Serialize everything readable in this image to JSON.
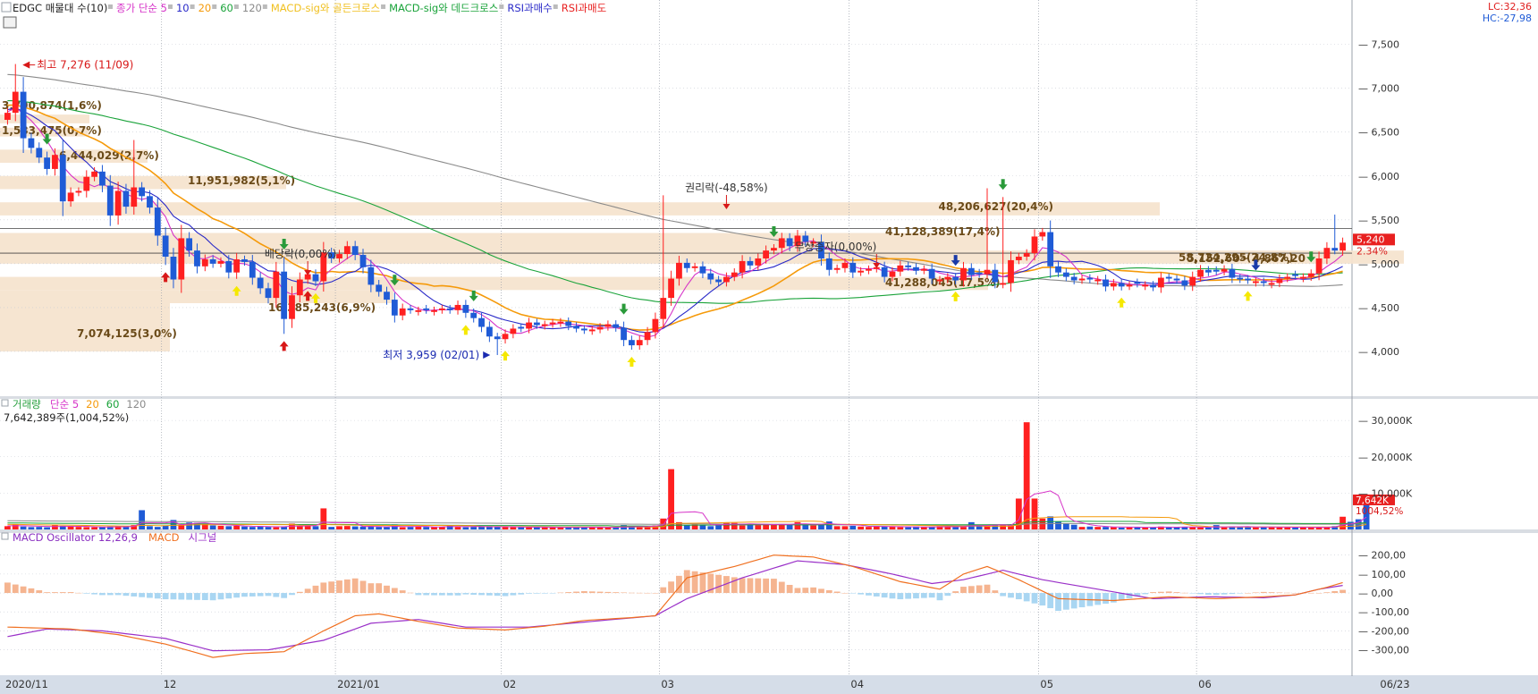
{
  "colors": {
    "up": "#ff2020",
    "down": "#1f5bd6",
    "ma5": "#d633c8",
    "ma10": "#2929c8",
    "ma20": "#f59a0a",
    "ma60": "#1aa33a",
    "ma120": "#8a8a8a",
    "grid": "#c8ccd4",
    "band": "#f5e4cf",
    "macd": "#f07020",
    "signal": "#9a30c8",
    "osc_pos": "#f5b490",
    "osc_neg": "#a9d6f2",
    "badge": "#e82020"
  },
  "chart_data": [
    {
      "type": "candlestick",
      "title": "EDGC 매물대 수(10)",
      "legend": [
        {
          "text": "종가 단순 5",
          "color": "#d633c8"
        },
        {
          "text": "10",
          "color": "#2929c8"
        },
        {
          "text": "20",
          "color": "#f59a0a"
        },
        {
          "text": "60",
          "color": "#1aa33a"
        },
        {
          "text": "120",
          "color": "#8a8a8a"
        },
        {
          "text": "MACD-sig와 골든크로스",
          "color": "#f0c020"
        },
        {
          "text": "MACD-sig와 데드크로스",
          "color": "#1aa33a"
        },
        {
          "text": "RSI과매수",
          "color": "#2929c8"
        },
        {
          "text": "RSI과매도",
          "color": "#e82020"
        }
      ],
      "corner": [
        "LC:32,36",
        "HC:-27,98"
      ],
      "ylim": [
        3500,
        7700
      ],
      "yticks": [
        4000,
        4500,
        5000,
        5500,
        6000,
        6500,
        7000,
        7500
      ],
      "ytick_labels": [
        "4,000",
        "4,500",
        "5,000",
        "5,500",
        "6,000",
        "6,500",
        "7,000",
        "7,500"
      ],
      "x_labels": [
        {
          "i": 0,
          "text": "2020/11"
        },
        {
          "i": 20,
          "text": "12"
        },
        {
          "i": 42,
          "text": "2021/01"
        },
        {
          "i": 63,
          "text": "02"
        },
        {
          "i": 83,
          "text": "03"
        },
        {
          "i": 107,
          "text": "04"
        },
        {
          "i": 131,
          "text": "05"
        },
        {
          "i": 151,
          "text": "06"
        },
        {
          "i": 169,
          "text": "06/23"
        }
      ],
      "closes": [
        6720,
        6960,
        6430,
        6320,
        6210,
        6080,
        6240,
        5710,
        5810,
        5830,
        5990,
        6050,
        5890,
        5550,
        5830,
        5650,
        5870,
        5770,
        5640,
        5320,
        5080,
        4820,
        5290,
        5150,
        4970,
        5050,
        5000,
        5030,
        4900,
        5050,
        5020,
        4840,
        4720,
        4610,
        4910,
        4370,
        4640,
        4820,
        4880,
        4800,
        5130,
        5060,
        5110,
        5200,
        5100,
        4960,
        4760,
        4680,
        4590,
        4410,
        4490,
        4470,
        4470,
        4470,
        4470,
        4490,
        4470,
        4530,
        4440,
        4380,
        4280,
        4170,
        4140,
        4200,
        4260,
        4260,
        4330,
        4300,
        4310,
        4330,
        4340,
        4290,
        4260,
        4240,
        4250,
        4280,
        4310,
        4270,
        4130,
        4070,
        4130,
        4220,
        4370,
        4610,
        4830,
        5010,
        4950,
        4970,
        4890,
        4820,
        4790,
        4850,
        4900,
        5030,
        4980,
        5060,
        5150,
        5180,
        5290,
        5200,
        5320,
        5250,
        5250,
        5060,
        4930,
        4950,
        5010,
        4900,
        4920,
        4940,
        4960,
        4850,
        4910,
        4980,
        4960,
        4920,
        4940,
        4830,
        4820,
        4850,
        4810,
        4950,
        4870,
        4880,
        4930,
        4790,
        4780,
        5040,
        5080,
        5120,
        5310,
        5360,
        4970,
        4900,
        4850,
        4810,
        4830,
        4820,
        4820,
        4740,
        4780,
        4740,
        4760,
        4770,
        4760,
        4730,
        4840,
        4830,
        4810,
        4750,
        4850,
        4930,
        4900,
        4910,
        4940,
        4840,
        4820,
        4810,
        4800,
        4780,
        4780,
        4830,
        4850,
        4860,
        4850,
        4890,
        5060,
        5180,
        5150,
        5240
      ],
      "series": [
        {
          "name": "종가 단순 5"
        },
        {
          "name": "10"
        },
        {
          "name": "20"
        },
        {
          "name": "60"
        },
        {
          "name": "120"
        }
      ],
      "price_badge": {
        "price": "5,240",
        "pct": "2.34%",
        "value": 5240
      },
      "volume_profile": [
        {
          "lo": 5550,
          "hi": 5700,
          "label": "48,206,627(20,4%)"
        },
        {
          "lo": 5000,
          "hi": 5150,
          "label": "58,724,295(24,8%)"
        },
        {
          "lo": 4550,
          "hi": 4700,
          "label": "16,385,243(6,9%)"
        },
        {
          "lo": 4700,
          "hi": 4850,
          "label": "41,288,045(17,5%)"
        },
        {
          "lo": 5150,
          "hi": 5350,
          "label": "41,128,389(17,4%)"
        },
        {
          "lo": 5850,
          "hi": 6000,
          "label": "11,951,982(5,1%)"
        },
        {
          "lo": 6150,
          "hi": 6300,
          "label": "6,444,029(2,7%)"
        },
        {
          "lo": 6450,
          "hi": 6550,
          "label": "1,583,475(0,7%)"
        },
        {
          "lo": 6600,
          "hi": 6700,
          "label": "3,790,874(1,6%)"
        },
        {
          "lo": 4000,
          "hi": 4550,
          "label": "7,074,125(3,0%)"
        }
      ],
      "range_text": "5,152,60~ 4,867,20",
      "high_note": "최고 7,276 (11/09)",
      "high_value": 7276,
      "low_note": "최저 3,959 (02/01)",
      "low_value": 3959,
      "events": [
        {
          "i": 38,
          "text": "배당락(0,00%)"
        },
        {
          "i": 91,
          "text": "권리락(-48,58%)"
        },
        {
          "i": 110,
          "text": "무상증자(0,00%)"
        }
      ],
      "signals": {
        "golden": [
          29,
          38,
          39,
          58,
          63,
          79,
          120,
          141,
          157
        ],
        "dead": [
          5,
          35,
          49,
          59,
          78,
          97,
          126,
          165
        ],
        "rsi_over": [
          120,
          158
        ],
        "rsi_under": [
          20,
          35,
          38
        ]
      }
    },
    {
      "type": "bar",
      "title": "거래량",
      "legend": [
        {
          "text": "단순 5",
          "color": "#d633c8"
        },
        {
          "text": "20",
          "color": "#f59a0a"
        },
        {
          "text": "60",
          "color": "#1aa33a"
        },
        {
          "text": "120",
          "color": "#8a8a8a"
        }
      ],
      "header_value": "7,642,389주(1,004,52%)",
      "ylim": [
        0,
        32000
      ],
      "yticks": [
        10000,
        20000,
        30000
      ],
      "ytick_labels": [
        "10,000K",
        "20,000K",
        "30,000K"
      ],
      "values": [
        900,
        1400,
        800,
        650,
        700,
        600,
        1200,
        1000,
        800,
        700,
        650,
        600,
        700,
        800,
        900,
        750,
        1200,
        5300,
        900,
        700,
        1000,
        2600,
        1300,
        1900,
        1800,
        1500,
        1100,
        1000,
        900,
        1000,
        800,
        700,
        900,
        700,
        600,
        800,
        1600,
        900,
        1000,
        900,
        5800,
        700,
        900,
        950,
        850,
        800,
        750,
        700,
        650,
        1400,
        600,
        700,
        800,
        700,
        650,
        700,
        1200,
        700,
        600,
        700,
        800,
        900,
        700,
        650,
        600,
        600,
        700,
        650,
        600,
        500,
        550,
        600,
        600,
        650,
        700,
        500,
        500,
        600,
        1200,
        800,
        700,
        700,
        1100,
        3000,
        16600,
        2000,
        1200,
        1400,
        1200,
        900,
        1600,
        1800,
        1800,
        1100,
        1500,
        1200,
        1500,
        1500,
        1400,
        1300,
        2000,
        1500,
        1100,
        1300,
        2200,
        900,
        900,
        1000,
        800,
        700,
        900,
        800,
        750,
        650,
        600,
        800,
        650,
        700,
        900,
        750,
        650,
        700,
        2000,
        900,
        1200,
        1200,
        1100,
        1100,
        8500,
        29500,
        8500,
        3000,
        3600,
        2200,
        1600,
        1300,
        700,
        800,
        700,
        700,
        600,
        500,
        650,
        700,
        500,
        550,
        800,
        600,
        650,
        700,
        600,
        600,
        500,
        1200,
        600,
        800,
        650,
        700,
        600,
        650,
        700,
        600,
        600,
        500,
        700,
        600,
        700,
        500,
        900,
        3500,
        2100,
        2800,
        7642
      ],
      "price_badge": {
        "value": "7,642K",
        "pct": "1004,52%"
      }
    },
    {
      "type": "line",
      "title": "MACD Oscillator 12,26,9",
      "legend": [
        {
          "text": "MACD",
          "color": "#f07020"
        },
        {
          "text": "시그널",
          "color": "#9a30c8"
        }
      ],
      "ylim": [
        -420,
        260
      ],
      "yticks": [
        -300,
        -200,
        -100,
        0,
        100,
        200
      ],
      "ytick_labels": [
        "-300,00",
        "-200,00",
        "-100,00",
        "0,00",
        "100,00",
        "200,00"
      ],
      "keyframes_macd": [
        [
          0,
          -180
        ],
        [
          8,
          -190
        ],
        [
          14,
          -220
        ],
        [
          20,
          -270
        ],
        [
          26,
          -340
        ],
        [
          30,
          -320
        ],
        [
          35,
          -310
        ],
        [
          40,
          -200
        ],
        [
          44,
          -120
        ],
        [
          47,
          -110
        ],
        [
          52,
          -150
        ],
        [
          57,
          -185
        ],
        [
          63,
          -195
        ],
        [
          68,
          -175
        ],
        [
          73,
          -145
        ],
        [
          79,
          -130
        ],
        [
          82,
          -120
        ],
        [
          86,
          80
        ],
        [
          92,
          140
        ],
        [
          97,
          200
        ],
        [
          102,
          190
        ],
        [
          107,
          140
        ],
        [
          113,
          60
        ],
        [
          118,
          20
        ],
        [
          121,
          100
        ],
        [
          124,
          140
        ],
        [
          128,
          70
        ],
        [
          133,
          -30
        ],
        [
          140,
          -40
        ],
        [
          147,
          -20
        ],
        [
          153,
          -30
        ],
        [
          159,
          -20
        ],
        [
          163,
          -10
        ],
        [
          167,
          30
        ],
        [
          169,
          55
        ]
      ],
      "keyframes_signal": [
        [
          0,
          -230
        ],
        [
          5,
          -190
        ],
        [
          12,
          -200
        ],
        [
          20,
          -240
        ],
        [
          26,
          -305
        ],
        [
          33,
          -300
        ],
        [
          40,
          -250
        ],
        [
          46,
          -160
        ],
        [
          52,
          -140
        ],
        [
          58,
          -180
        ],
        [
          66,
          -180
        ],
        [
          74,
          -150
        ],
        [
          82,
          -120
        ],
        [
          86,
          -30
        ],
        [
          93,
          80
        ],
        [
          100,
          170
        ],
        [
          106,
          150
        ],
        [
          112,
          100
        ],
        [
          117,
          50
        ],
        [
          121,
          70
        ],
        [
          126,
          120
        ],
        [
          131,
          70
        ],
        [
          138,
          20
        ],
        [
          145,
          -30
        ],
        [
          152,
          -20
        ],
        [
          159,
          -25
        ],
        [
          163,
          -10
        ],
        [
          166,
          20
        ],
        [
          169,
          40
        ]
      ]
    }
  ]
}
